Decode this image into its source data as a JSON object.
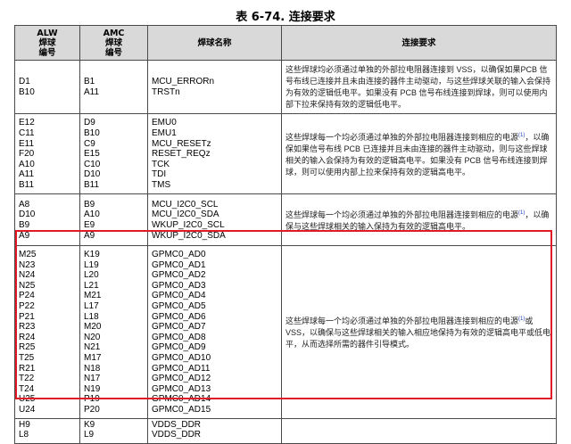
{
  "title": "表 6-74. 连接要求",
  "headers": {
    "alw": [
      "ALW",
      "焊球",
      "编号"
    ],
    "amc": [
      "AMC",
      "焊球",
      "编号"
    ],
    "name": "焊球名称",
    "req": "连接要求"
  },
  "groups": [
    {
      "alw": [
        "D1",
        "B10"
      ],
      "amc": [
        "B1",
        "A11"
      ],
      "names": [
        "MCU_ERRORn",
        "TRSTn"
      ],
      "req": "这些焊球均必须通过单独的外部拉电阻器连接到 VSS，以确保如果PCB 信号布线已连接并且未由连接的器件主动驱动，与这些焊球关联的输入会保持为有效的逻辑低电平。如果没有 PCB 信号布线连接到焊球，则可以使用内部下拉来保持有效的逻辑低电平。",
      "fn": ""
    },
    {
      "alw": [
        "E12",
        "C11",
        "E11",
        "F20",
        "A10",
        "A11",
        "B11"
      ],
      "amc": [
        "D9",
        "B10",
        "C9",
        "E15",
        "C10",
        "D10",
        "B11"
      ],
      "names": [
        "EMU0",
        "EMU1",
        "MCU_RESETz",
        "RESET_REQz",
        "TCK",
        "TDI",
        "TMS"
      ],
      "req": "这些焊球每一个均必须通过单独的外部拉电阻器连接到相应的电源",
      "fn": "(1)",
      "req2": "，以确保如果信号布线 PCB 已连接并且未由连接的器件主动驱动，则与这些焊球相关的输入会保持为有效的逻辑高电平。如果没有 PCB 信号布线连接到焊球，则可以使用内部上拉来保持有效的逻辑高电平。"
    },
    {
      "alw": [
        "A8",
        "D10",
        "B9",
        "A9"
      ],
      "amc": [
        "B9",
        "A10",
        "E9",
        "A9"
      ],
      "names": [
        "MCU_I2C0_SCL",
        "MCU_I2C0_SDA",
        "WKUP_I2C0_SCL",
        "WKUP_I2C0_SDA"
      ],
      "req": "这些焊球每一个均必须通过单独的外部拉电阻器连接到相应的电源",
      "fn": "(1)",
      "req2": "，以确保与这些焊球相关的输入保持为有效的逻辑高电平。"
    },
    {
      "alw": [
        "M25",
        "N23",
        "N24",
        "N25",
        "P24",
        "P22",
        "P21",
        "R23",
        "R24",
        "R25",
        "T25",
        "R21",
        "T22",
        "T24",
        "U25",
        "U24"
      ],
      "amc": [
        "K19",
        "L19",
        "L20",
        "L21",
        "M21",
        "L17",
        "L18",
        "M20",
        "N20",
        "N21",
        "M17",
        "N18",
        "N17",
        "N19",
        "P19",
        "P20"
      ],
      "names": [
        "GPMC0_AD0",
        "GPMC0_AD1",
        "GPMC0_AD2",
        "GPMC0_AD3",
        "GPMC0_AD4",
        "GPMC0_AD5",
        "GPMC0_AD6",
        "GPMC0_AD7",
        "GPMC0_AD8",
        "GPMC0_AD9",
        "GPMC0_AD10",
        "GPMC0_AD11",
        "GPMC0_AD12",
        "GPMC0_AD13",
        "GPMC0_AD14",
        "GPMC0_AD15"
      ],
      "req": "这些焊球每一个均必须通过单独的外部拉电阻器连接到相应的电源",
      "fn": "(1)",
      "req2": "或 VSS，以确保与这些焊球相关的输入相应地保持为有效的逻辑高电平或低电平，从而选择所需的器件引导模式。"
    },
    {
      "alw": [
        "H9",
        "L8"
      ],
      "amc": [
        "K9",
        "L9"
      ],
      "names": [
        "VDDS_DDR",
        "VDDS_DDR"
      ],
      "req": "",
      "fn": ""
    }
  ],
  "colors": {
    "highlight": "#e01b24",
    "header_bg": "#d9d9d9"
  }
}
